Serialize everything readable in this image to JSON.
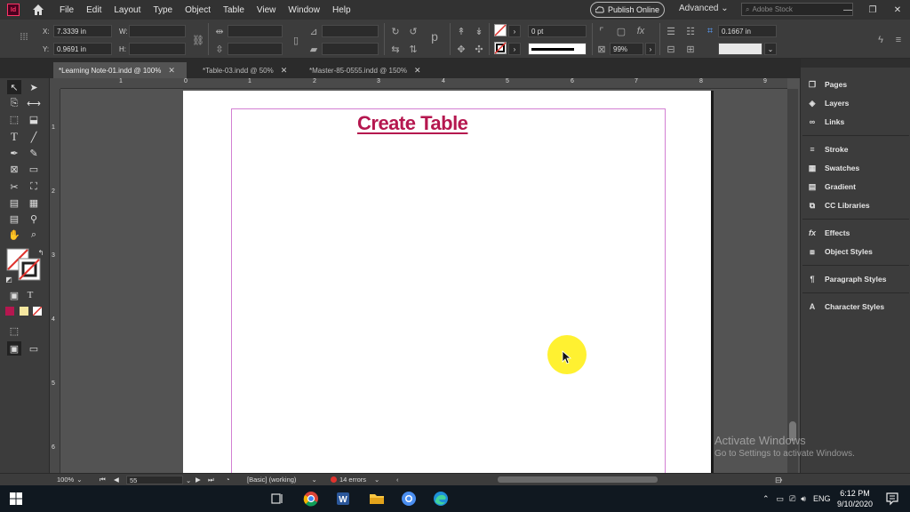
{
  "app": {
    "logo": "Id"
  },
  "menu": [
    "File",
    "Edit",
    "Layout",
    "Type",
    "Object",
    "Table",
    "View",
    "Window",
    "Help"
  ],
  "publish_label": "Publish Online",
  "workspace_label": "Advanced",
  "stock_placeholder": "Adobe Stock",
  "controlbar": {
    "x_label": "X:",
    "x_value": "7.3339 in",
    "y_label": "Y:",
    "y_value": "0.9691 in",
    "w_label": "W:",
    "h_label": "H:",
    "stroke_weight": "0 pt",
    "opacity": "99%",
    "offset": "0.1667 in"
  },
  "tabs": [
    {
      "label": "*Learning Note-01.indd @ 100%",
      "active": true
    },
    {
      "label": "*Table-03.indd @ 50%",
      "active": false
    },
    {
      "label": "*Master-85-0555.indd @ 150%",
      "active": false
    }
  ],
  "ruler_h": [
    "1",
    "0",
    "1",
    "2",
    "3",
    "4",
    "5",
    "6",
    "7",
    "8",
    "9"
  ],
  "ruler_v": [
    "1",
    "2",
    "3",
    "4",
    "5",
    "6"
  ],
  "page": {
    "title": "Create Table"
  },
  "panels": [
    {
      "label": "Pages",
      "icon": "pages-icon"
    },
    {
      "label": "Layers",
      "icon": "layers-icon"
    },
    {
      "label": "Links",
      "icon": "links-icon"
    },
    {
      "label": "Stroke",
      "icon": "stroke-icon"
    },
    {
      "label": "Swatches",
      "icon": "swatches-icon"
    },
    {
      "label": "Gradient",
      "icon": "gradient-icon"
    },
    {
      "label": "CC Libraries",
      "icon": "cc-libraries-icon"
    },
    {
      "label": "Effects",
      "icon": "effects-icon"
    },
    {
      "label": "Object Styles",
      "icon": "object-styles-icon"
    },
    {
      "label": "Paragraph Styles",
      "icon": "paragraph-styles-icon"
    },
    {
      "label": "Character Styles",
      "icon": "character-styles-icon"
    }
  ],
  "statusbar": {
    "zoom": "100%",
    "page_number": "55",
    "style": "[Basic] (working)",
    "errors": "14 errors"
  },
  "watermark": {
    "title": "Activate Windows",
    "subtitle": "Go to Settings to activate Windows."
  },
  "taskbar": {
    "language": "ENG",
    "time": "6:12 PM",
    "date": "9/10/2020"
  }
}
